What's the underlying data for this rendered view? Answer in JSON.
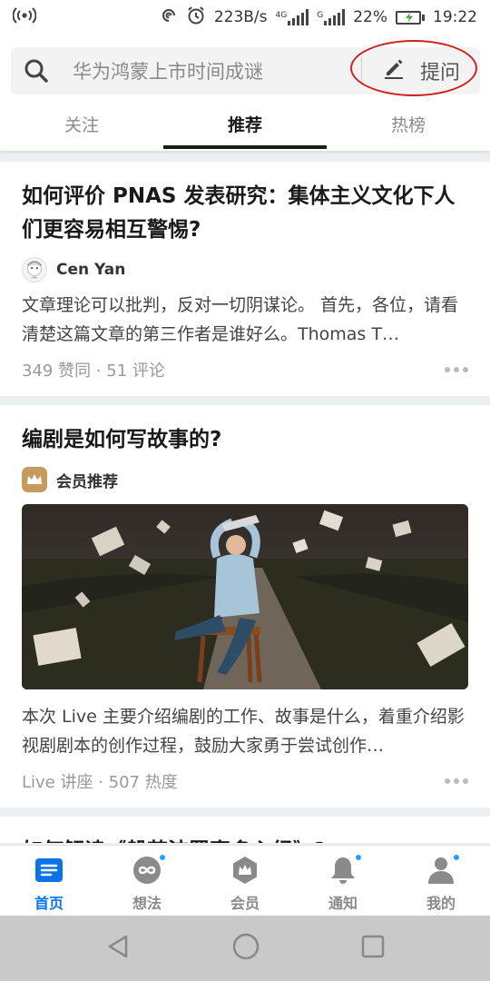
{
  "status_bar": {
    "left_icon": "hotspot-icon",
    "speed": "223B/s",
    "net1": "4G",
    "net2": "G",
    "battery": "22%",
    "time": "19:22",
    "battery_level": 0.22
  },
  "search": {
    "placeholder": "华为鸿蒙上市时间成谜",
    "ask_label": "提问"
  },
  "tabs": [
    {
      "label": "关注",
      "active": false
    },
    {
      "label": "推荐",
      "active": true
    },
    {
      "label": "热榜",
      "active": false
    }
  ],
  "feed": [
    {
      "title": "如何评价 PNAS 发表研究：集体主义文化下人们更容易相互警惕?",
      "author": "Cen Yan",
      "excerpt": "文章理论可以批判，反对一切阴谋论。 首先，各位，请看清楚这篇文章的第三作者是谁好么。Thomas T…",
      "meta": "349 赞同 · 51 评论"
    },
    {
      "title": "编剧是如何写故事的?",
      "author": "会员推荐",
      "excerpt": "本次 Live 主要介绍编剧的工作、故事是什么，着重介绍影视剧剧本的创作过程，鼓励大家勇于尝试创作…",
      "meta": "Live 讲座 · 507 热度"
    },
    {
      "title": "如何解读《般若波罗蜜多心经》?"
    }
  ],
  "bottom_nav": [
    {
      "label": "首页",
      "icon": "home-icon",
      "active": true,
      "dot": false
    },
    {
      "label": "想法",
      "icon": "ideas-icon",
      "active": false,
      "dot": true
    },
    {
      "label": "会员",
      "icon": "member-icon",
      "active": false,
      "dot": false
    },
    {
      "label": "通知",
      "icon": "bell-icon",
      "active": false,
      "dot": true
    },
    {
      "label": "我的",
      "icon": "profile-icon",
      "active": false,
      "dot": true
    }
  ],
  "colors": {
    "accent": "#0a74e6",
    "annotation": "#d02020",
    "badge_dot": "#1aa3ff"
  }
}
